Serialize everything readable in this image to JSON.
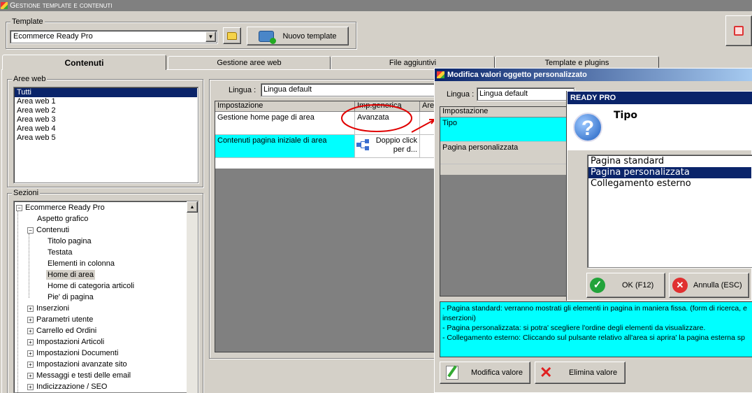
{
  "window": {
    "title": "Gestione template e contenuti"
  },
  "template_group": {
    "label": "Template",
    "selected": "Ecommerce Ready Pro",
    "new_button": "Nuovo template"
  },
  "tabs": [
    "Contenuti",
    "Gestione aree web",
    "File aggiuntivi",
    "Template e plugins"
  ],
  "aree_web": {
    "label": "Aree web",
    "items": [
      "Tutti",
      "Area web 1",
      "Area web 2",
      "Area web 3",
      "Area web 4",
      "Area web 5"
    ]
  },
  "sezioni": {
    "label": "Sezioni",
    "items": [
      "Ecommerce Ready Pro",
      "Aspetto grafico",
      "Contenuti",
      "Titolo pagina",
      "Testata",
      "Elementi in colonna",
      "Home di area",
      "Home di categoria articoli",
      "Pie' di pagina",
      "Inserzioni",
      "Parametri utente",
      "Carrello ed Ordini",
      "Impostazioni Articoli",
      "Impostazioni Documenti",
      "Impostazioni avanzate sito",
      "Messaggi e testi delle email",
      "Indicizzazione / SEO"
    ]
  },
  "main": {
    "lingua_label": "Lingua :",
    "lingua_value": "Lingua default",
    "columns": [
      "Impostazione",
      "Imp.generica",
      "Are"
    ],
    "rows": [
      {
        "setting": "Gestione home page di area",
        "value": "Avanzata"
      },
      {
        "setting": "Contenuti pagina iniziale di area",
        "value": "Doppio click per d..."
      }
    ]
  },
  "modifica_dialog": {
    "title": "Modifica valori oggetto personalizzato",
    "lingua_label": "Lingua :",
    "lingua_value": "Lingua default",
    "column": "Impostazione",
    "rows": [
      "Tipo",
      "Pagina personalizzata"
    ],
    "description": [
      "- Pagina standard: verranno mostrati gli elementi in pagina in maniera fissa. (form di ricerca, e",
      "inserzioni)",
      "- Pagina personalizzata: si potra' scegliere l'ordine degli elementi da visualizzare.",
      "- Collegamento esterno: Cliccando sul pulsante relativo all'area si aprira' la pagina esterna sp"
    ],
    "modify_button": "Modifica valore",
    "delete_button": "Elimina valore"
  },
  "readypro_dialog": {
    "title": "READY PRO",
    "heading": "Tipo",
    "options": [
      "Pagina standard",
      "Pagina personalizzata",
      "Collegamento esterno"
    ],
    "selected": "Pagina personalizzata",
    "ok_button": "OK (F12)",
    "cancel_button": "Annulla (ESC)"
  },
  "colors": {
    "selection": "#0a246a",
    "cyan": "#00ffff",
    "annotation": "#e00000"
  }
}
